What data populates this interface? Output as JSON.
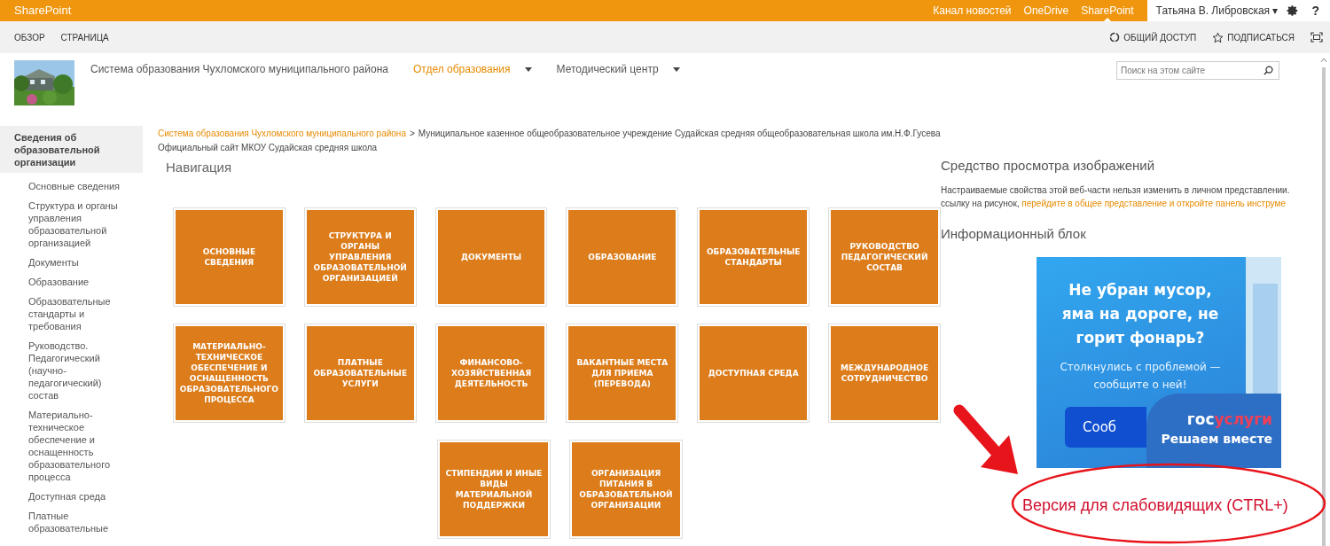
{
  "suite_bar": {
    "brand": "SharePoint",
    "links": [
      {
        "label": "Канал новостей",
        "selected": false
      },
      {
        "label": "OneDrive",
        "selected": false
      },
      {
        "label": "SharePoint",
        "selected": true
      }
    ],
    "user": "Татьяна В. Либровская",
    "user_caret": "▾",
    "help_glyph": "?"
  },
  "ribbon": {
    "tabs": [
      "ОБЗОР",
      "СТРАНИЦА"
    ],
    "actions": [
      {
        "kind": "share",
        "label": "ОБЩИЙ ДОСТУП"
      },
      {
        "kind": "follow",
        "label": "ПОДПИСАТЬСЯ"
      }
    ]
  },
  "header": {
    "nav": [
      {
        "label": "Система образования Чухломского муниципального района",
        "selected": false,
        "has_menu": false
      },
      {
        "label": "Отдел образования",
        "selected": true,
        "has_menu": true
      },
      {
        "label": "Методический центр",
        "selected": false,
        "has_menu": true
      }
    ],
    "search": {
      "placeholder": "Поиск на этом сайте"
    }
  },
  "sidebar": {
    "items": [
      {
        "label": "Сведения об образовательной организации",
        "selected": true,
        "children": [
          {
            "label": "Основные сведения"
          },
          {
            "label": "Структура и органы управления образовательной организацией"
          },
          {
            "label": "Документы"
          },
          {
            "label": "Образование"
          },
          {
            "label": "Образовательные стандарты и требования"
          },
          {
            "label": "Руководство. Педагогический (научно-педагогический) состав"
          },
          {
            "label": "Материально-техническое обеспечение и оснащенность образовательного процесса"
          },
          {
            "label": "Доступная среда"
          },
          {
            "label": "Платные образовательные"
          }
        ]
      }
    ]
  },
  "breadcrumb": {
    "items": [
      {
        "text": "Система образования Чухломского муниципального района",
        "link": true
      },
      {
        "text": "Муниципальное казенное общеобразовательное учреждение Судайская средняя общеобразовательная школа им.Н.Ф.Гусева",
        "link": false
      }
    ],
    "separator": ">",
    "page_title": "Официальный сайт МКОУ Судайская средняя школа"
  },
  "navigation": {
    "title": "Навигация",
    "rows": [
      [
        "ОСНОВНЫЕ СВЕДЕНИЯ",
        "СТРУКТУРА И ОРГАНЫ УПРАВЛЕНИЯ ОБРАЗОВАТЕЛЬНОЙ ОРГАНИЗАЦИЕЙ",
        "ДОКУМЕНТЫ",
        "ОБРАЗОВАНИЕ",
        "ОБРАЗОВАТЕЛЬНЫЕ СТАНДАРТЫ",
        "РУКОВОДСТВО ПЕДАГОГИЧЕСКИЙ СОСТАВ"
      ],
      [
        "МАТЕРИАЛЬНО-ТЕХНИЧЕСКОЕ ОБЕСПЕЧЕНИЕ И ОСНАЩЕННОСТЬ ОБРАЗОВАТЕЛЬНОГО ПРОЦЕССА",
        "ПЛАТНЫЕ ОБРАЗОВАТЕЛЬНЫЕ УСЛУГИ",
        "ФИНАНСОВО-ХОЗЯЙСТВЕННАЯ ДЕЯТЕЛЬНОСТЬ",
        "ВАКАНТНЫЕ МЕСТА ДЛЯ ПРИЕМА (ПЕРЕВОДА)",
        "ДОСТУПНАЯ СРЕДА",
        "МЕЖДУНАРОДНОЕ СОТРУДНИЧЕСТВО"
      ],
      [
        "",
        "",
        "СТИПЕНДИИ И ИНЫЕ ВИДЫ МАТЕРИАЛЬНОЙ ПОДДЕРЖКИ",
        "ОРГАНИЗАЦИЯ ПИТАНИЯ В ОБРАЗОВАТЕЛЬНОЙ ОРГАНИЗАЦИИ"
      ]
    ]
  },
  "image_viewer": {
    "title": "Средство просмотра изображений",
    "note_line1": "Настраиваемые свойства этой веб-части нельзя изменить в личном представлении.",
    "note_line2": "ссылку на рисунок, ",
    "note_link": "перейдите в общее представление и откройте панель инструме"
  },
  "info_block": {
    "title": "Информационный блок",
    "banner": {
      "headline": "Не убран мусор, яма на дороге, не горит фонарь?",
      "subtitle": "Столкнулись с проблемой — сообщите о ней!",
      "button": "Сооб",
      "logo_first": "гос",
      "logo_second": "услуги",
      "slogan": "Решаем вместе"
    }
  },
  "accessibility_link": "Версия для слабовидящих (CTRL+)"
}
